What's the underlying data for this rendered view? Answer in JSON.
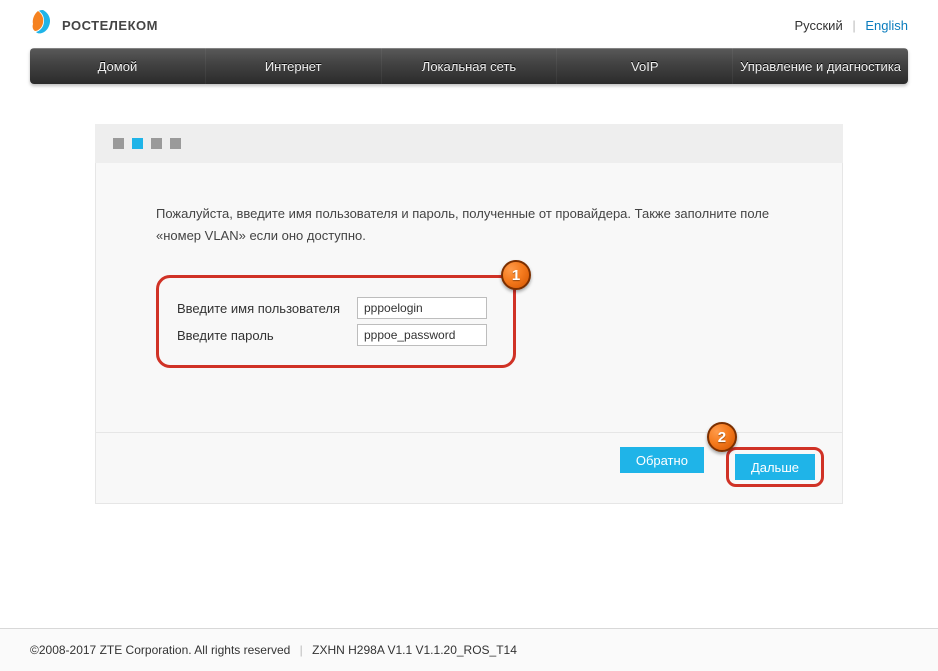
{
  "header": {
    "logo_text": "РОСТЕЛЕКОМ",
    "lang_ru": "Русский",
    "lang_en": "English"
  },
  "nav": {
    "items": [
      "Домой",
      "Интернет",
      "Локальная сеть",
      "VoIP",
      "Управление и диагностика"
    ]
  },
  "wizard": {
    "active_step_index": 1,
    "total_steps": 4,
    "intro": "Пожалуйста, введите имя пользователя и пароль, полученные от провайдера. Также заполните поле «номер VLAN» если оно доступно.",
    "username_label": "Введите имя пользователя",
    "password_label": "Введите пароль",
    "username_value": "pppoelogin",
    "password_value": "pppoe_password",
    "back_label": "Обратно",
    "next_label": "Дальше"
  },
  "annotations": {
    "badge1": "1",
    "badge2": "2"
  },
  "footer": {
    "copyright": "©2008-2017 ZTE Corporation. All rights reserved",
    "version": "ZXHN H298A V1.1 V1.1.20_ROS_T14"
  },
  "colors": {
    "accent": "#1fb4e8",
    "highlight": "#d03226"
  }
}
